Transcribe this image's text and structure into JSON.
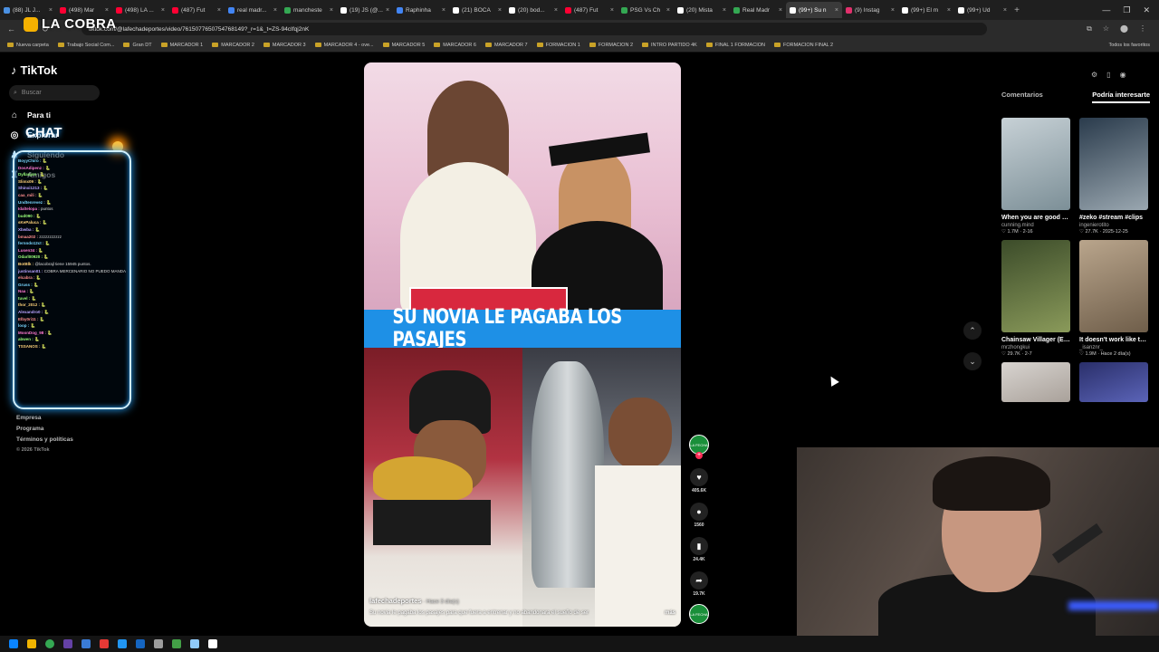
{
  "browser": {
    "tabs": [
      {
        "label": "(88) JL J...",
        "color": "#4a90e2"
      },
      {
        "label": "(498) Mar",
        "color": "#ff0033"
      },
      {
        "label": "(498) LA ...",
        "color": "#ff0033"
      },
      {
        "label": "(487) Fut",
        "color": "#ff0033"
      },
      {
        "label": "real madr...",
        "color": "#4285f4"
      },
      {
        "label": "mancheste",
        "color": "#34a853"
      },
      {
        "label": "(19) JS (@...",
        "color": "#ffffff"
      },
      {
        "label": "Raphinha",
        "color": "#4285f4"
      },
      {
        "label": "(21) BOCA",
        "color": "#ffffff"
      },
      {
        "label": "(20) bod...",
        "color": "#ffffff"
      },
      {
        "label": "(487) Fut",
        "color": "#ff0033"
      },
      {
        "label": "PSG Vs Ch",
        "color": "#34a853"
      },
      {
        "label": "(20) Mista",
        "color": "#ffffff"
      },
      {
        "label": "Real Madr",
        "color": "#34a853"
      },
      {
        "label": "(99+) Su n",
        "color": "#ffffff",
        "active": true
      },
      {
        "label": "(9) Instag",
        "color": "#e1306c"
      },
      {
        "label": "(99+) El m",
        "color": "#ffffff"
      },
      {
        "label": "(99+) Ud",
        "color": "#ffffff"
      }
    ],
    "url": "tiktok.com/@lafechadeportes/video/7615077650754768149?_r=1&_t=ZS-94cIfqj2nK",
    "bookmarks": [
      "Nueva carpeta",
      "Trabajo Social Com...",
      "Gran DT",
      "MARCADOR 1",
      "MARCADOR 2",
      "MARCADOR 3",
      "MARCADOR 4 - ove...",
      "MARCADOR 5",
      "MARCADOR 6",
      "MARCADOR 7",
      "FORMACION 1",
      "FORMACION 2",
      "INTRO PARTIDO 4K",
      "FINAL 1 FORMACION",
      "FORMACION FINAL 2"
    ],
    "bookmarks_right": "Todos los favoritos"
  },
  "overlay": {
    "logo_text": "LA COBRA",
    "chat_title": "CHAT"
  },
  "sidebar": {
    "brand": "TikTok",
    "search_placeholder": "Buscar",
    "nav": [
      {
        "label": "Para ti",
        "icon": "home-icon",
        "glyph": "⌂"
      },
      {
        "label": "Explorar",
        "icon": "compass-icon",
        "glyph": "◎"
      },
      {
        "label": "Siguiendo",
        "icon": "following-icon",
        "glyph": "♟"
      },
      {
        "label": "Amigos",
        "icon": "friends-icon",
        "glyph": "♜"
      }
    ],
    "footer": [
      "Empresa",
      "Programa",
      "Términos y políticas",
      "© 2026 TikTok"
    ]
  },
  "chat": [
    {
      "user": "BoyyChiro :",
      "msg": "🐍"
    },
    {
      "user": "DosAdipenz :",
      "msg": "🐍"
    },
    {
      "user": "Dyllanjon :",
      "msg": "🐍"
    },
    {
      "user": "Slimx09 :",
      "msg": "🐍"
    },
    {
      "user": "Shinxi1213 :",
      "msg": "🐍"
    },
    {
      "user": "caa_mili :",
      "msg": "🐍"
    },
    {
      "user": "Undtenrevez :",
      "msg": "🐍"
    },
    {
      "user": "Idaltelopa :",
      "msg": "puntos"
    },
    {
      "user": "bud090 :",
      "msg": "🐍"
    },
    {
      "user": "sKePaluca :",
      "msg": "🐍"
    },
    {
      "user": "Xbwba :",
      "msg": "🐍"
    },
    {
      "user": "bmaa202 :",
      "msg": "zzzzzzzzzzz"
    },
    {
      "user": "fernndo12ct :",
      "msg": "🐍"
    },
    {
      "user": "Lusen34 :",
      "msg": "🐍"
    },
    {
      "user": "Odarl00920 :",
      "msg": "🐍"
    },
    {
      "user": "BotBlk :",
      "msg": "@lacobrajl tiene 15945 puntos."
    },
    {
      "user": "justinsan01 :",
      "msg": "COBRA MERCENARIO NO PUEDO MANDARTE NADA PORQUE ESTA TODO CARO MERCENARIO"
    },
    {
      "user": "elcabra :",
      "msg": "🐍"
    },
    {
      "user": "Gruss :",
      "msg": "🐍"
    },
    {
      "user": "Naa :",
      "msg": "🐍"
    },
    {
      "user": "tuvel :",
      "msg": "🐍"
    },
    {
      "user": "thor_2012 :",
      "msg": "🐍"
    },
    {
      "user": "Alexandro0 :",
      "msg": "🐍"
    },
    {
      "user": "Elby0ri11 :",
      "msg": "🐍"
    },
    {
      "user": "loop :",
      "msg": "🐍"
    },
    {
      "user": "MoonDog_98 :",
      "msg": "🐍"
    },
    {
      "user": "abwen :",
      "msg": "🐍"
    },
    {
      "user": "TSSANOS :",
      "msg": "🐍"
    }
  ],
  "video": {
    "banner": "SU NOVIA LE PAGABA LOS PASAJES",
    "author": "lafechadeportes",
    "ago": "· Hace 3 día(s)",
    "description": "Su novia le pagaba los pasajes para que fuera a entrenar y no abandonara el sueño de ser",
    "more": "más",
    "likes": "405.6K",
    "comments": "1560",
    "saves": "24.4K",
    "shares": "19.7K",
    "account_badge": "LA FECHA"
  },
  "right_panel": {
    "tabs": [
      "Comentarios",
      "Podría interesarte"
    ],
    "active_tab": 1,
    "cards": [
      {
        "title": "When you are good at choosin...",
        "author": "cunning.mind",
        "meta": "♡ 1.7M · 2-16",
        "c1": "#c7d1d6",
        "c2": "#7c8f97"
      },
      {
        "title": "#zeko #stream #clips",
        "author": "ingenierotito",
        "meta": "♡ 27.7K · 2025-12-25",
        "c1": "#2a3b4c",
        "c2": "#9aa7b0"
      },
      {
        "title": "Chainsaw Villager (El Salvador) | Re...",
        "author": "mrzhongkui",
        "meta": "♡ 29.7K · 2-7",
        "c1": "#3c4c2a",
        "c2": "#8a9a5a"
      },
      {
        "title": "It doesn't work like that in real lif...",
        "author": "_isanznr_",
        "meta": "♡ 1.9M · Hace 2 día(s)",
        "c1": "#b9a58c",
        "c2": "#6f5e4a"
      },
      {
        "title": "",
        "author": "",
        "meta": "",
        "c1": "#d8d4d0",
        "c2": "#a9a19a"
      },
      {
        "title": "",
        "author": "",
        "meta": "",
        "c1": "#2a2f6a",
        "c2": "#5b64b8"
      }
    ]
  },
  "colors": {
    "accent": "#fe2c55",
    "banner": "#1e90e6",
    "chat_glow": "#2aa7ff"
  }
}
